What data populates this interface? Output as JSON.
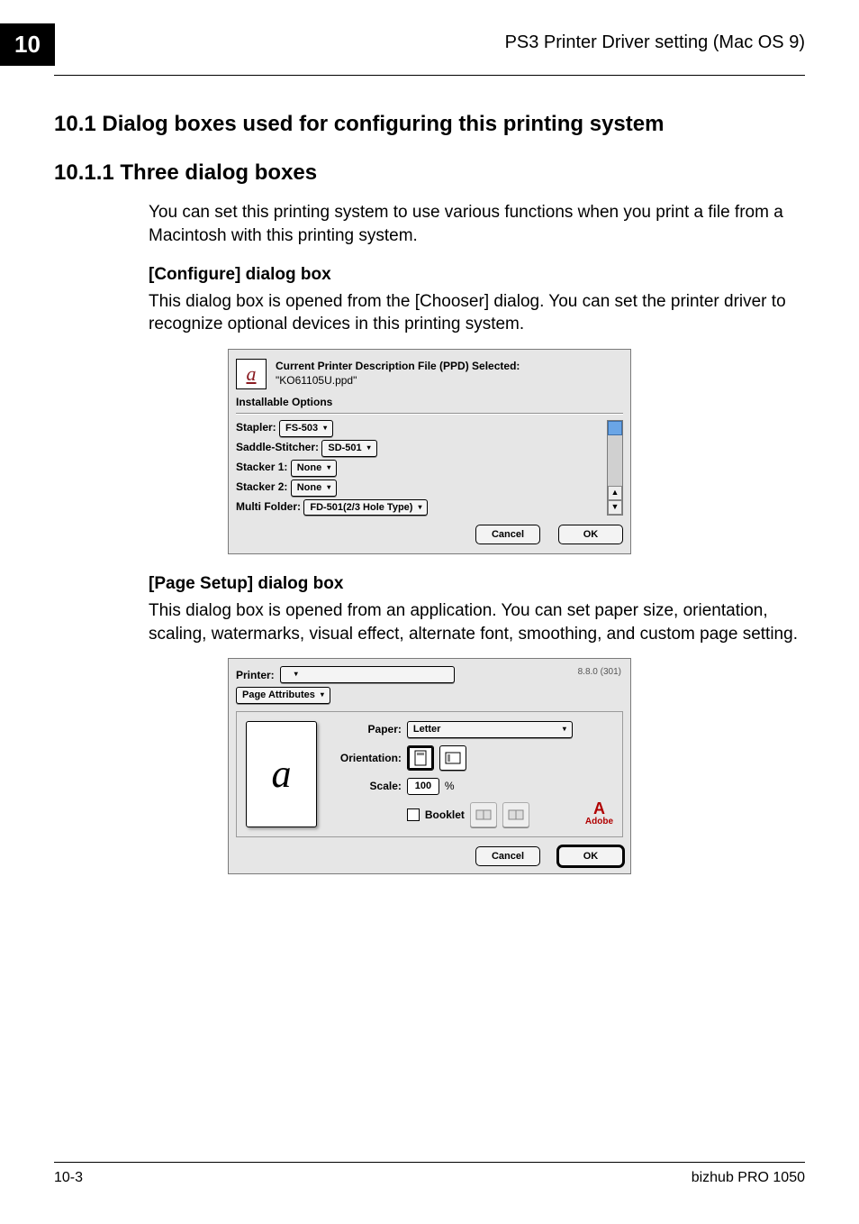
{
  "chapter_number": "10",
  "header_right": "PS3 Printer Driver setting (Mac OS 9)",
  "section_1_heading": "10.1    Dialog boxes used for configuring this printing system",
  "section_2_heading": "10.1.1 Three dialog boxes",
  "intro_para_text": "You can set this printing system to use various functions when you print a file from a Macintosh with this printing system.",
  "configure_heading": "[Configure] dialog box",
  "configure_text": "This dialog box is opened from the [Chooser] dialog. You can set the printer driver to recognize optional devices in this printing system.",
  "configure_dialog": {
    "title_line1": "Current Printer Description File (PPD) Selected:",
    "ppd_name": "\"KO61105U.ppd\"",
    "installable_label": "Installable Options",
    "rows": {
      "stapler": {
        "label": "Stapler:",
        "value": "FS-503"
      },
      "saddle": {
        "label": "Saddle-Stitcher:",
        "value": "SD-501"
      },
      "stacker1": {
        "label": "Stacker 1:",
        "value": "None"
      },
      "stacker2": {
        "label": "Stacker 2:",
        "value": "None"
      },
      "multifolder": {
        "label": "Multi Folder:",
        "value": "FD-501(2/3 Hole Type)"
      }
    },
    "cancel": "Cancel",
    "ok": "OK"
  },
  "pagesetup_heading": "[Page Setup] dialog box",
  "pagesetup_text": "This dialog box is opened from an application. You can set paper size, orientation, scaling, watermarks, visual effect, alternate font, smoothing, and custom page setting.",
  "pagesetup_dialog": {
    "printer_label": "Printer:",
    "section_value": "Page Attributes",
    "version": "8.8.0 (301)",
    "paper_label": "Paper:",
    "paper_value": "Letter",
    "orientation_label": "Orientation:",
    "scale_label": "Scale:",
    "scale_value": "100",
    "scale_unit": "%",
    "booklet_label": "Booklet",
    "preview_glyph": "a",
    "adobe": "Adobe",
    "cancel": "Cancel",
    "ok": "OK"
  },
  "footer_left": "10-3",
  "footer_right": "bizhub PRO 1050"
}
